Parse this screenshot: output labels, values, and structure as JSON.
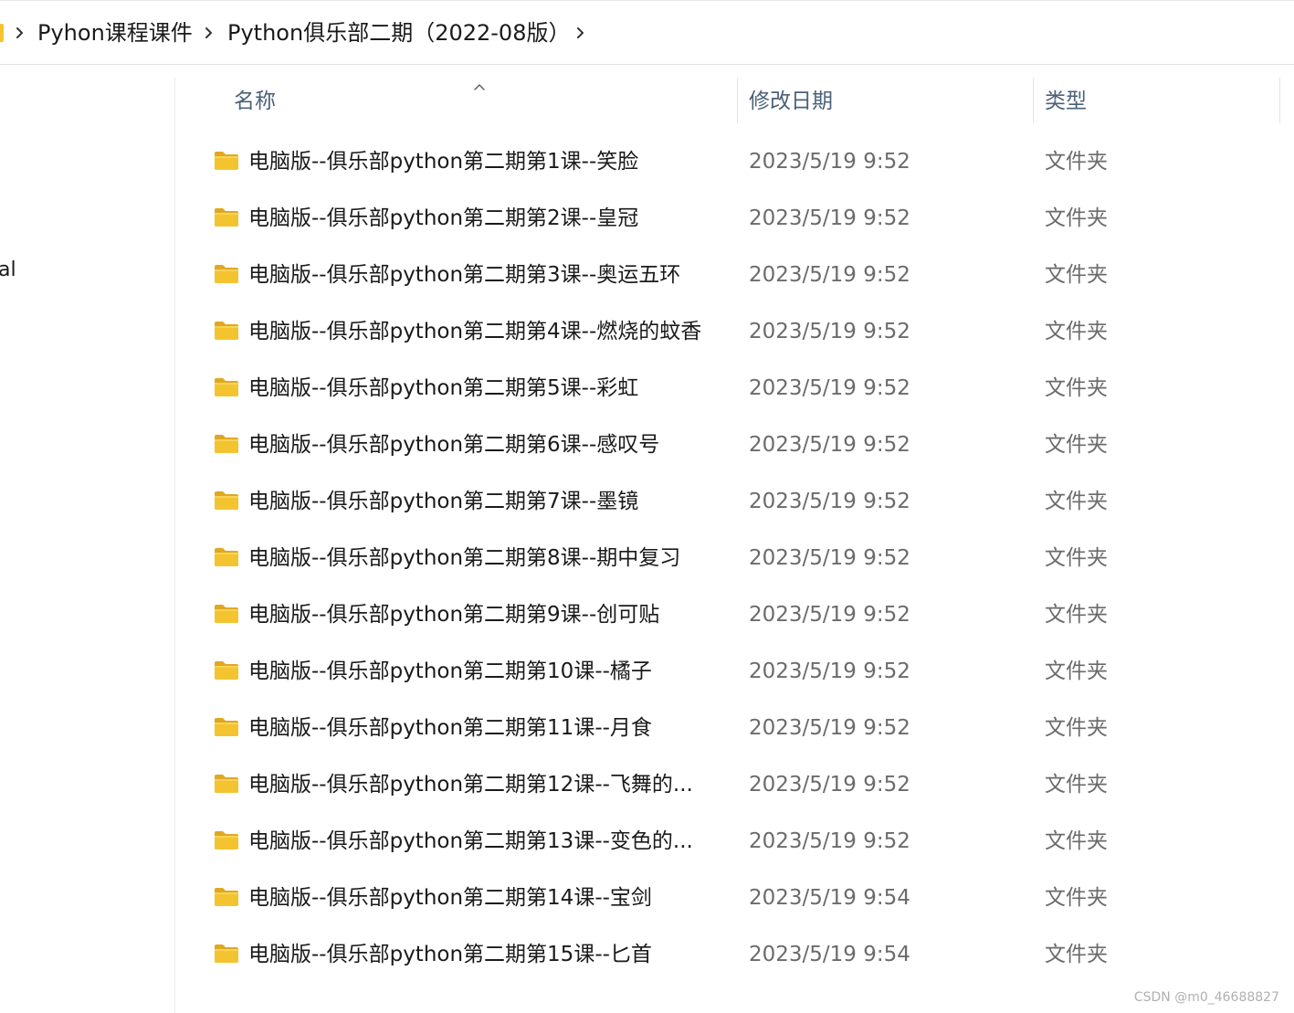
{
  "breadcrumb": {
    "items": [
      {
        "label": "Pyhon课程课件"
      },
      {
        "label": "Python俱乐部二期（2022-08版）"
      }
    ]
  },
  "nav": {
    "partial_item_label": "al"
  },
  "list": {
    "columns": {
      "name": "名称",
      "date": "修改日期",
      "type": "类型"
    },
    "sorted_by": "name",
    "rows": [
      {
        "name": "电脑版--俱乐部python第二期第1课--笑脸",
        "date": "2023/5/19 9:52",
        "type": "文件夹"
      },
      {
        "name": "电脑版--俱乐部python第二期第2课--皇冠",
        "date": "2023/5/19 9:52",
        "type": "文件夹"
      },
      {
        "name": "电脑版--俱乐部python第二期第3课--奥运五环",
        "date": "2023/5/19 9:52",
        "type": "文件夹"
      },
      {
        "name": "电脑版--俱乐部python第二期第4课--燃烧的蚊香",
        "date": "2023/5/19 9:52",
        "type": "文件夹"
      },
      {
        "name": "电脑版--俱乐部python第二期第5课--彩虹",
        "date": "2023/5/19 9:52",
        "type": "文件夹"
      },
      {
        "name": "电脑版--俱乐部python第二期第6课--感叹号",
        "date": "2023/5/19 9:52",
        "type": "文件夹"
      },
      {
        "name": "电脑版--俱乐部python第二期第7课--墨镜",
        "date": "2023/5/19 9:52",
        "type": "文件夹"
      },
      {
        "name": "电脑版--俱乐部python第二期第8课--期中复习",
        "date": "2023/5/19 9:52",
        "type": "文件夹"
      },
      {
        "name": "电脑版--俱乐部python第二期第9课--创可贴",
        "date": "2023/5/19 9:52",
        "type": "文件夹"
      },
      {
        "name": "电脑版--俱乐部python第二期第10课--橘子",
        "date": "2023/5/19 9:52",
        "type": "文件夹"
      },
      {
        "name": "电脑版--俱乐部python第二期第11课--月食",
        "date": "2023/5/19 9:52",
        "type": "文件夹"
      },
      {
        "name": "电脑版--俱乐部python第二期第12课--飞舞的...",
        "date": "2023/5/19 9:52",
        "type": "文件夹"
      },
      {
        "name": "电脑版--俱乐部python第二期第13课--变色的...",
        "date": "2023/5/19 9:52",
        "type": "文件夹"
      },
      {
        "name": "电脑版--俱乐部python第二期第14课--宝剑",
        "date": "2023/5/19 9:54",
        "type": "文件夹"
      },
      {
        "name": "电脑版--俱乐部python第二期第15课--匕首",
        "date": "2023/5/19 9:54",
        "type": "文件夹"
      }
    ]
  },
  "watermark": "CSDN @m0_46688827",
  "colors": {
    "folder": "#f4c430",
    "header_text": "#4c607a",
    "secondary_text": "#6b6b6b"
  }
}
